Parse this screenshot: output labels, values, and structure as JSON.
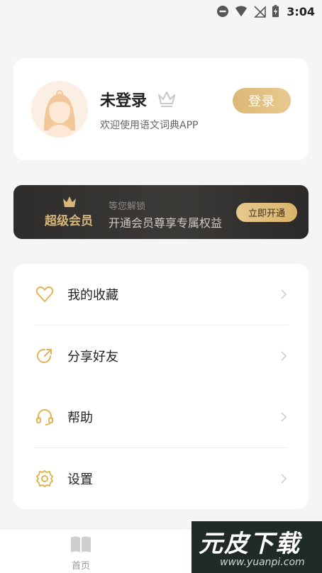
{
  "status_bar": {
    "time": "3:04",
    "icons": [
      "do-not-disturb-icon",
      "wifi-icon",
      "no-signal-icon",
      "battery-charging-icon"
    ]
  },
  "profile": {
    "username": "未登录",
    "welcome": "欢迎使用语文词典APP",
    "login_label": "登录",
    "icons": {
      "avatar": "avatar",
      "crown": "crown-icon"
    }
  },
  "vip": {
    "title": "超级会员",
    "subtitle": "等您解锁",
    "description": "开通会员尊享专属权益",
    "open_label": "立即开通",
    "accent": "#d7b779"
  },
  "menu": {
    "items": [
      {
        "label": "我的收藏",
        "icon": "heart-icon"
      },
      {
        "label": "分享好友",
        "icon": "share-icon"
      },
      {
        "label": "帮助",
        "icon": "headset-icon"
      },
      {
        "label": "设置",
        "icon": "gear-icon"
      }
    ],
    "accent": "#e3b455"
  },
  "bottom_nav": {
    "home_label": "首页",
    "home_icon": "book-icon"
  },
  "watermark": {
    "text": "元皮下载",
    "url": "www.yuanpi.com"
  }
}
